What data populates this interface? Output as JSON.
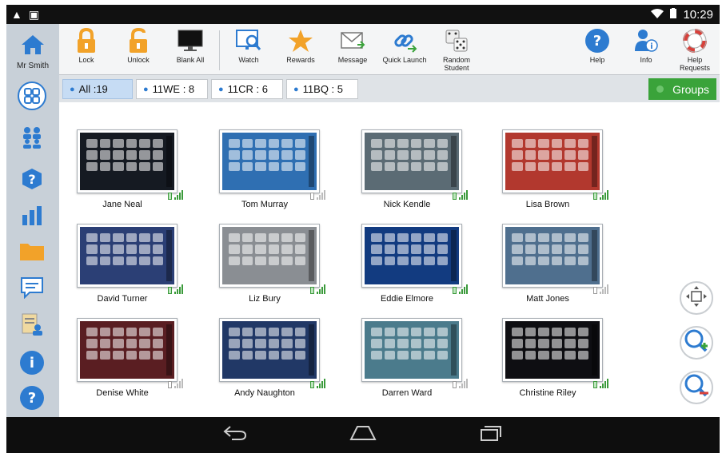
{
  "status_bar": {
    "time": "10:29",
    "icons": [
      "warning-icon",
      "image-icon",
      "wifi-icon",
      "battery-icon"
    ]
  },
  "user": {
    "name": "Mr Smith"
  },
  "toolbar": {
    "items": [
      {
        "label": "Lock",
        "icon": "lock-icon"
      },
      {
        "label": "Unlock",
        "icon": "unlock-icon"
      },
      {
        "label": "Blank All",
        "icon": "monitor-icon"
      },
      {
        "label": "Watch",
        "icon": "watch-icon"
      },
      {
        "label": "Rewards",
        "icon": "star-icon"
      },
      {
        "label": "Message",
        "icon": "envelope-icon"
      },
      {
        "label": "Quick Launch",
        "icon": "link-icon"
      },
      {
        "label": "Random\nStudent",
        "icon": "dice-icon"
      },
      {
        "label": "Help",
        "icon": "help-icon"
      },
      {
        "label": "Info",
        "icon": "info-icon"
      },
      {
        "label": "Help Requests",
        "icon": "lifebuoy-icon"
      }
    ]
  },
  "tabs": [
    {
      "label": "All :19",
      "active": true
    },
    {
      "label": "11WE : 8",
      "active": false
    },
    {
      "label": "11CR : 6",
      "active": false
    },
    {
      "label": "11BQ : 5",
      "active": false
    }
  ],
  "groups_button": {
    "label": "Groups"
  },
  "sidebar": {
    "items": [
      "thumbnails-icon",
      "students-icon",
      "help-cloud-icon",
      "chart-icon",
      "folder-icon",
      "chat-icon",
      "report-icon",
      "info-icon",
      "help-icon"
    ]
  },
  "students": [
    {
      "name": "Jane Neal",
      "bg": "#151a22",
      "battery_low": false
    },
    {
      "name": "Tom Murray",
      "bg": "#2f6fb2",
      "battery_low": true
    },
    {
      "name": "Nick Kendle",
      "bg": "#5b6b74",
      "battery_low": false
    },
    {
      "name": "Lisa Brown",
      "bg": "#b2382e",
      "battery_low": false
    },
    {
      "name": "David Turner",
      "bg": "#2b3f75",
      "battery_low": false
    },
    {
      "name": "Liz Bury",
      "bg": "#8a8e93",
      "battery_low": false
    },
    {
      "name": "Eddie Elmore",
      "bg": "#123b80",
      "battery_low": false
    },
    {
      "name": "Matt Jones",
      "bg": "#4f6f8e",
      "battery_low": true
    },
    {
      "name": "Denise White",
      "bg": "#5a1e22",
      "battery_low": true
    },
    {
      "name": "Andy Naughton",
      "bg": "#213866",
      "battery_low": false
    },
    {
      "name": "Darren Ward",
      "bg": "#4b7b8c",
      "battery_low": true
    },
    {
      "name": "Christine Riley",
      "bg": "#0e0e12",
      "battery_low": false
    }
  ],
  "colors": {
    "accent": "#2d7bd0",
    "groups": "#3aa33a",
    "battery_ok": "#3b9a3b"
  }
}
